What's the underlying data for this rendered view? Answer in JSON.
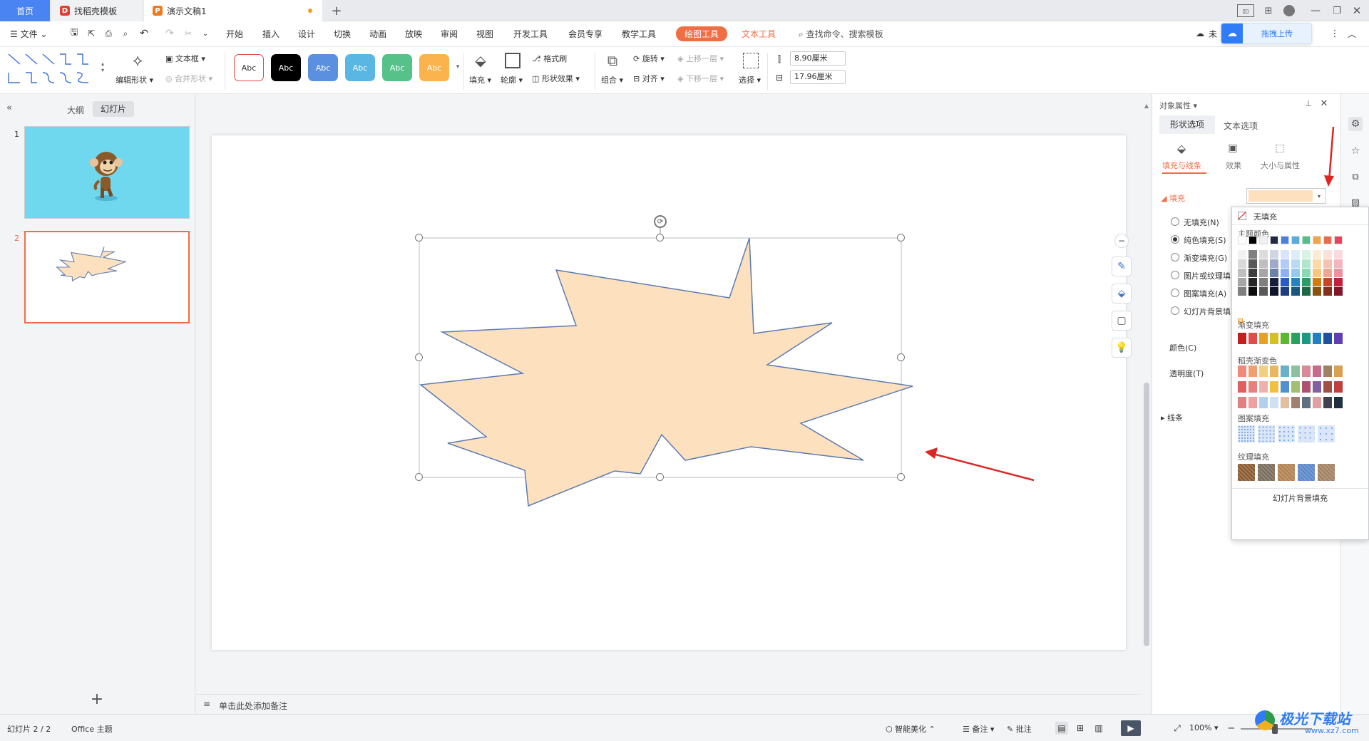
{
  "tabs": {
    "home": "首页",
    "template": "找稻壳模板",
    "doc": "演示文稿1"
  },
  "menu": {
    "file": "文件",
    "items": [
      "开始",
      "插入",
      "设计",
      "切换",
      "动画",
      "放映",
      "审阅",
      "视图",
      "开发工具",
      "会员专享",
      "教学工具"
    ],
    "drawing_tools": "绘图工具",
    "text_tools": "文本工具",
    "search": "查找命令、搜索模板",
    "sync_partial": "未",
    "upload": "拖拽上传"
  },
  "ribbon": {
    "edit_shape": "编辑形状",
    "textbox": "文本框",
    "merge_shape": "合并形状",
    "style_label": "Abc",
    "fill": "填充",
    "outline": "轮廓",
    "format_painter": "格式刷",
    "shape_effect": "形状效果",
    "group": "组合",
    "rotate": "旋转",
    "align": "对齐",
    "bring_forward": "上移一层",
    "send_backward": "下移一层",
    "select": "选择",
    "height": "8.90厘米",
    "width": "17.96厘米"
  },
  "left": {
    "outline_tab": "大纲",
    "slides_tab": "幻灯片",
    "slide1_num": "1",
    "slide2_num": "2"
  },
  "notes": {
    "placeholder": "单击此处添加备注"
  },
  "props": {
    "title": "对象属性",
    "shape_options": "形状选项",
    "text_options": "文本选项",
    "fill_line": "填充与线条",
    "effects": "效果",
    "size_props": "大小与属性",
    "fill_header": "填充",
    "options": [
      "无填充(N)",
      "纯色填充(S)",
      "渐变填充(G)",
      "图片或纹理填",
      "图案填充(A)",
      "幻灯片背景填"
    ],
    "color": "颜色(C)",
    "transparency": "透明度(T)",
    "line": "线条"
  },
  "colorpop": {
    "no_fill": "无填充",
    "theme_colors": "主题颜色",
    "gradient_fill": "渐变填充",
    "docer_gradient": "稻壳渐变色",
    "pattern_fill": "图案填充",
    "texture_fill": "纹理填充",
    "slide_bg_fill": "幻灯片背景填充"
  },
  "status": {
    "slide_info": "幻灯片 2 / 2",
    "theme": "Office 主题",
    "smart": "智能美化",
    "notes": "备注",
    "comments": "批注",
    "zoom": "100%",
    "watermark": "极光下载站",
    "watermark_url": "www.xz7.com"
  },
  "colors": {
    "shape_fill": "#fde0bd",
    "shape_stroke": "#5a7bb5",
    "accent": "#f16d44",
    "slide1_bg": "#6fd7ee"
  }
}
